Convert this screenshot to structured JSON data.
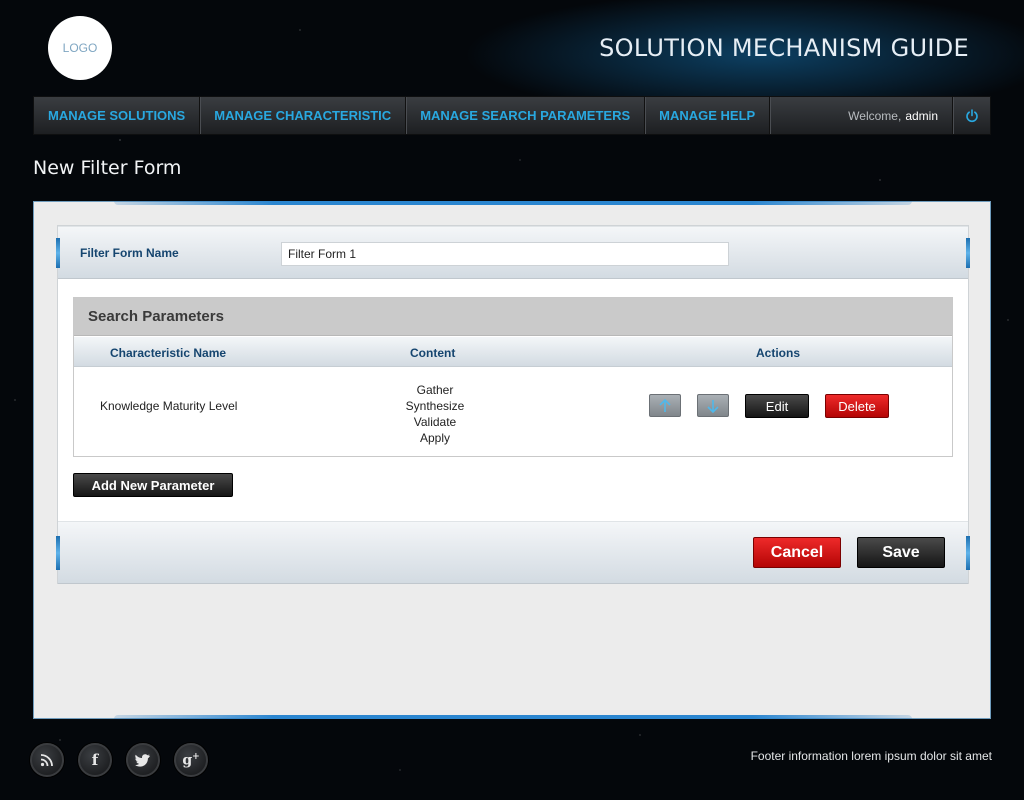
{
  "header": {
    "logo_text": "LOGO",
    "site_title": "SOLUTION MECHANISM GUIDE"
  },
  "nav": {
    "items": [
      {
        "label": "MANAGE SOLUTIONS"
      },
      {
        "label": "MANAGE CHARACTERISTIC"
      },
      {
        "label": "MANAGE SEARCH PARAMETERS"
      },
      {
        "label": "MANAGE HELP"
      }
    ],
    "welcome_prefix": "Welcome,",
    "username": "admin",
    "power_icon": "power-icon"
  },
  "page": {
    "title": "New Filter Form"
  },
  "form": {
    "name_label": "Filter Form Name",
    "name_value": "Filter Form 1",
    "search_params": {
      "title": "Search Parameters",
      "columns": [
        "Characteristic Name",
        "Content",
        "Actions"
      ],
      "rows": [
        {
          "characteristic": "Knowledge Maturity Level",
          "content": [
            "Gather",
            "Synthesize",
            "Validate",
            "Apply"
          ],
          "actions": {
            "up_icon": "arrow-up-icon",
            "down_icon": "arrow-down-icon",
            "edit_label": "Edit",
            "delete_label": "Delete"
          }
        }
      ]
    },
    "add_param_label": "Add New Parameter",
    "cancel_label": "Cancel",
    "save_label": "Save"
  },
  "footer": {
    "social_icons": [
      "rss-icon",
      "facebook-icon",
      "twitter-icon",
      "google-plus-icon"
    ],
    "text": "Footer information lorem ipsum dolor sit amet"
  },
  "colors": {
    "nav_link": "#29a8e0",
    "label_blue": "#15456f",
    "delete_red": "#d90f0f",
    "accent_blue": "#2b86d0"
  }
}
